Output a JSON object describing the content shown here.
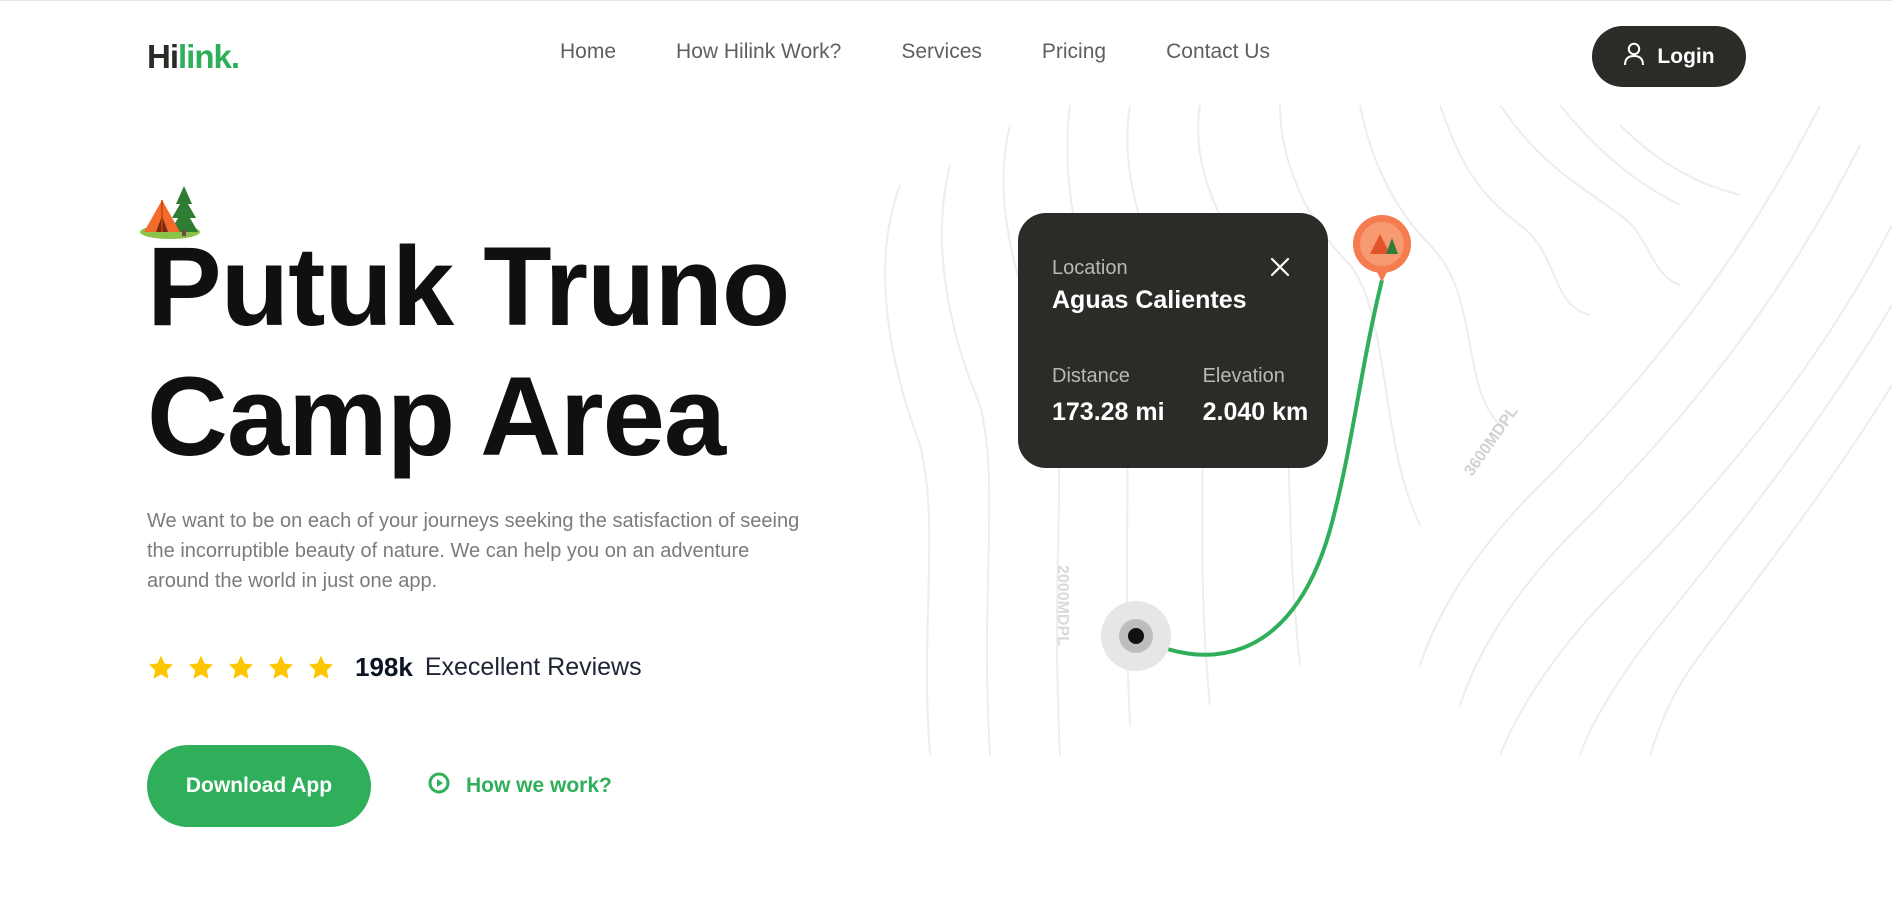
{
  "header": {
    "logo_part1": "Hi",
    "logo_part2": "link.",
    "nav": [
      "Home",
      "How Hilink Work?",
      "Services",
      "Pricing",
      "Contact Us"
    ],
    "login_label": "Login"
  },
  "hero": {
    "camp_icon": "camp-tent-icon",
    "title_line1": "Putuk Truno",
    "title_line2": "Camp Area",
    "description": "We want to be on each of your journeys seeking the satisfaction of seeing the incorruptible beauty of nature. We can help you on an adventure around the world in just one app.",
    "stars": 5,
    "review_count": "198k",
    "review_label": "Execellent Reviews",
    "download_label": "Download App",
    "how_label": "How we work?"
  },
  "map_card": {
    "location_label": "Location",
    "location_value": "Aguas Calientes",
    "distance_label": "Distance",
    "distance_value": "173.28 mi",
    "elevation_label": "Elevation",
    "elevation_value": "2.040 km"
  },
  "map": {
    "contour_label_1": "2000MDPL",
    "contour_label_2": "3600MDPL"
  },
  "colors": {
    "accent_green": "#30af5b",
    "dark": "#292c27",
    "star": "#fec601",
    "pin_orange": "#f47c4e"
  }
}
